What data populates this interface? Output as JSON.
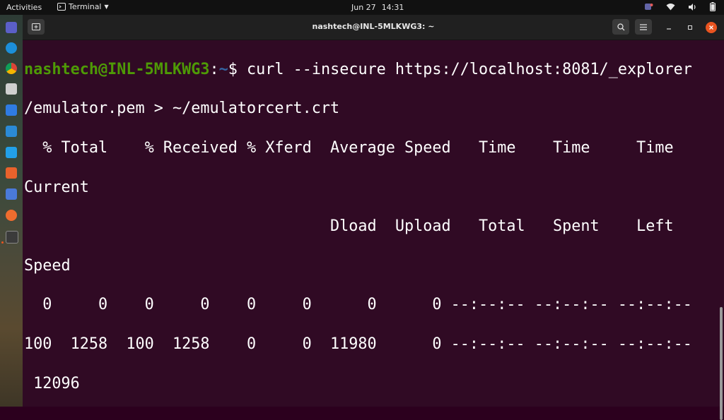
{
  "topbar": {
    "activities": "Activities",
    "app_name": "Terminal",
    "date": "Jun 27",
    "time": "14:31"
  },
  "dock": {
    "apps": [
      {
        "name": "teams-icon",
        "color": "#5b5fc7"
      },
      {
        "name": "edge-icon",
        "color": "#1c8fd9"
      },
      {
        "name": "chrome-icon",
        "color": "#e0b020"
      },
      {
        "name": "files-icon",
        "color": "#cfcfcf"
      },
      {
        "name": "docs-icon",
        "color": "#2f7be3"
      },
      {
        "name": "remote-desktop-icon",
        "color": "#2b8ad6"
      },
      {
        "name": "vscode-icon",
        "color": "#22a0e8"
      },
      {
        "name": "software-center-icon",
        "color": "#e8622c"
      },
      {
        "name": "calculator-icon",
        "color": "#4a7ad9"
      },
      {
        "name": "postman-icon",
        "color": "#ef6c2e"
      },
      {
        "name": "terminal-icon",
        "color": "#3b3b3b"
      }
    ]
  },
  "window": {
    "title": "nashtech@INL-5MLKWG3: ~"
  },
  "terminal": {
    "user_host": "nashtech@INL-5MLKWG3",
    "colon": ":",
    "path": "~",
    "prompt_symbol": "$",
    "command": " curl --insecure https://localhost:8081/_explorer",
    "output_lines": [
      "/emulator.pem > ~/emulatorcert.crt",
      "  % Total    % Received % Xferd  Average Speed   Time    Time     Time  ",
      "Current",
      "                                 Dload  Upload   Total   Spent    Left  ",
      "Speed",
      "  0     0    0     0    0     0      0      0 --:--:-- --:--:-- --:--:--",
      "100  1258  100  1258    0     0  11980      0 --:--:-- --:--:-- --:--:--",
      " 12096"
    ],
    "colors": {
      "background": "#300a24",
      "user": "#4e9a06",
      "path": "#3465a4",
      "text": "#ffffff"
    }
  }
}
